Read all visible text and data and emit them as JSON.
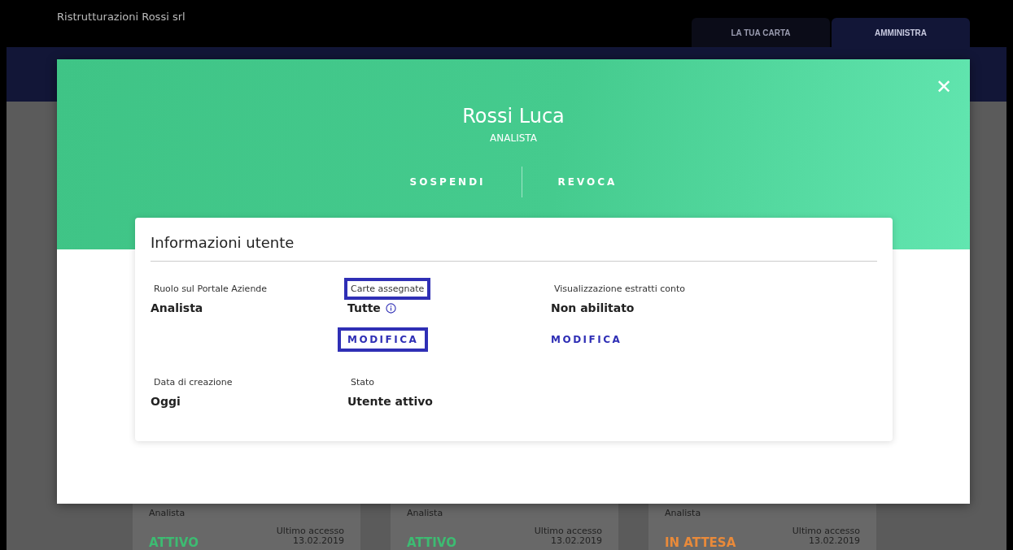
{
  "header": {
    "company": "Ristrutturazioni Rossi srl",
    "tabs": [
      {
        "label": "LA TUA CARTA",
        "selected": false
      },
      {
        "label": "AMMINISTRA",
        "selected": true
      }
    ]
  },
  "background_cards": [
    {
      "role": "Analista",
      "status": "ATTIVO",
      "color": "#3dbb72",
      "last_access_label": "Ultimo accesso",
      "last_access": "13.02.2019"
    },
    {
      "role": "Analista",
      "status": "ATTIVO",
      "color": "#3dbb72",
      "last_access_label": "Ultimo accesso",
      "last_access": "13.02.2019"
    },
    {
      "role": "Analista",
      "status": "IN ATTESA",
      "color": "#e98a3a",
      "last_access_label": "Ultimo accesso",
      "last_access": "13.02.2019"
    }
  ],
  "modal": {
    "close": "✕",
    "name": "Rossi Luca",
    "role": "ANALISTA",
    "actions": [
      "SOSPENDI",
      "REVOCA"
    ],
    "card": {
      "title": "Informazioni utente",
      "fields": [
        {
          "label": "Ruolo sul Portale Aziende",
          "value": "Analista",
          "info": false,
          "highlighted": false
        },
        {
          "label": "Carte assegnate",
          "value": "Tutte",
          "info": true,
          "highlighted": true,
          "action": {
            "label": "MODIFICA",
            "highlighted": true
          }
        },
        {
          "label": "Visualizzazione estratti conto",
          "value": "Non abilitato",
          "info": false,
          "highlighted": false,
          "action": {
            "label": "MODIFICA",
            "highlighted": false
          }
        },
        {
          "label": "Data di creazione",
          "value": "Oggi",
          "info": false,
          "highlighted": false
        },
        {
          "label": "Stato",
          "value": "Utente attivo",
          "info": false,
          "highlighted": false
        }
      ]
    }
  }
}
